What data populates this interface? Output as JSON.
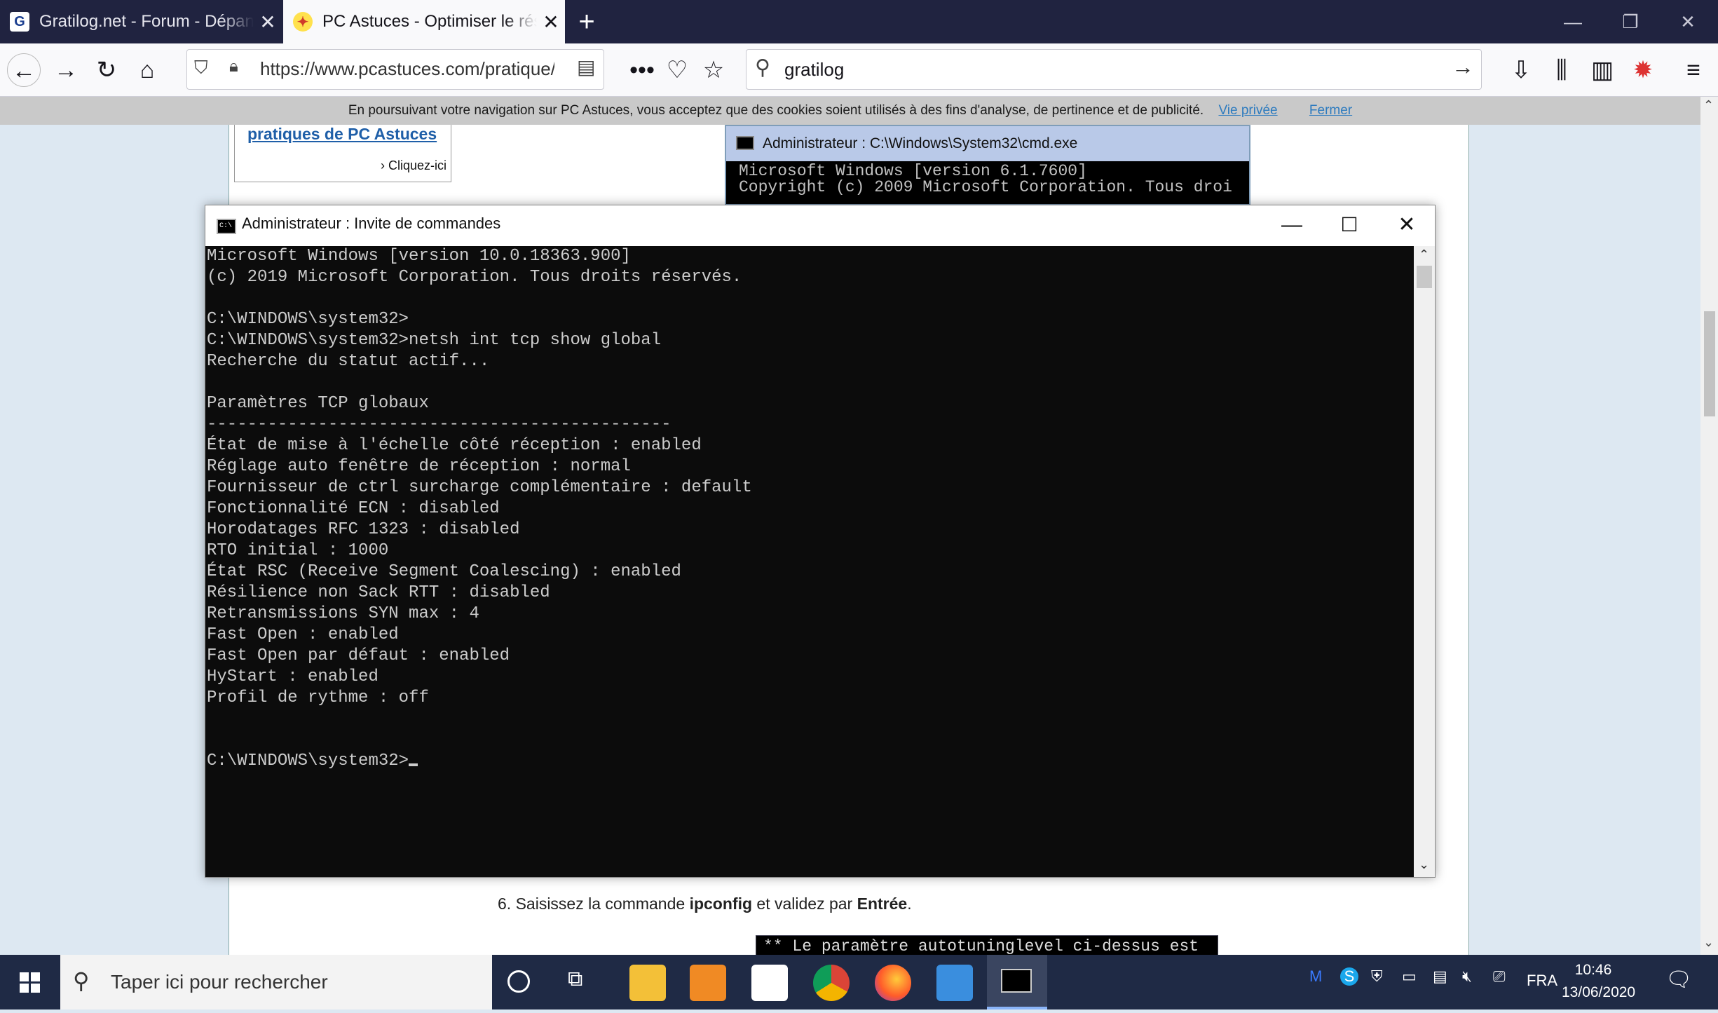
{
  "browser": {
    "tabs": [
      {
        "title": "Gratilog.net - Forum - Dépanna",
        "favicon": "G",
        "active": false
      },
      {
        "title": "PC Astuces - Optimiser le résea",
        "favicon": "✦",
        "active": true
      }
    ],
    "url": "https://www.pcastuces.com/pratique/wir",
    "search_value": "gratilog"
  },
  "page": {
    "cookie_text": "En poursuivant votre navigation sur PC Astuces, vous acceptez que des cookies soient utilisés à des fins d'analyse, de pertinence et de publicité.",
    "cookie_privacy": "Vie privée",
    "cookie_close": "Fermer",
    "promo_link": "pratiques de PC Astuces",
    "promo_more": "Cliquez-ici",
    "old_cmd_title": "Administrateur : C:\\Windows\\System32\\cmd.exe",
    "old_cmd_text": "Microsoft Windows [version 6.1.7600]\nCopyright (c) 2009 Microsoft Corporation. Tous droi",
    "step6_prefix": "6. Saisissez la commande ",
    "step6_cmd": "ipconfig",
    "step6_mid": " et validez par ",
    "step6_key": "Entrée",
    "step6_end": ".",
    "note_text": "** Le paramètre autotuninglevel ci-dessus est"
  },
  "cmd": {
    "title": "Administrateur : Invite de commandes",
    "output": "Microsoft Windows [version 10.0.18363.900]\n(c) 2019 Microsoft Corporation. Tous droits réservés.\n\nC:\\WINDOWS\\system32>\nC:\\WINDOWS\\system32>netsh int tcp show global\nRecherche du statut actif...\n\nParamètres TCP globaux\n----------------------------------------------\nÉtat de mise à l'échelle côté réception : enabled\nRéglage auto fenêtre de réception : normal\nFournisseur de ctrl surcharge complémentaire : default\nFonctionnalité ECN : disabled\nHorodatages RFC 1323 : disabled\nRTO initial : 1000\nÉtat RSC (Receive Segment Coalescing) : enabled\nRésilience non Sack RTT : disabled\nRetransmissions SYN max : 4\nFast Open : enabled\nFast Open par défaut : enabled\nHyStart : enabled\nProfil de rythme : off\n\n\nC:\\WINDOWS\\system32>"
  },
  "taskbar": {
    "search_placeholder": "Taper ici pour rechercher",
    "language": "FRA",
    "time": "10:46",
    "date": "13/06/2020",
    "accent": "#1f2a45"
  }
}
